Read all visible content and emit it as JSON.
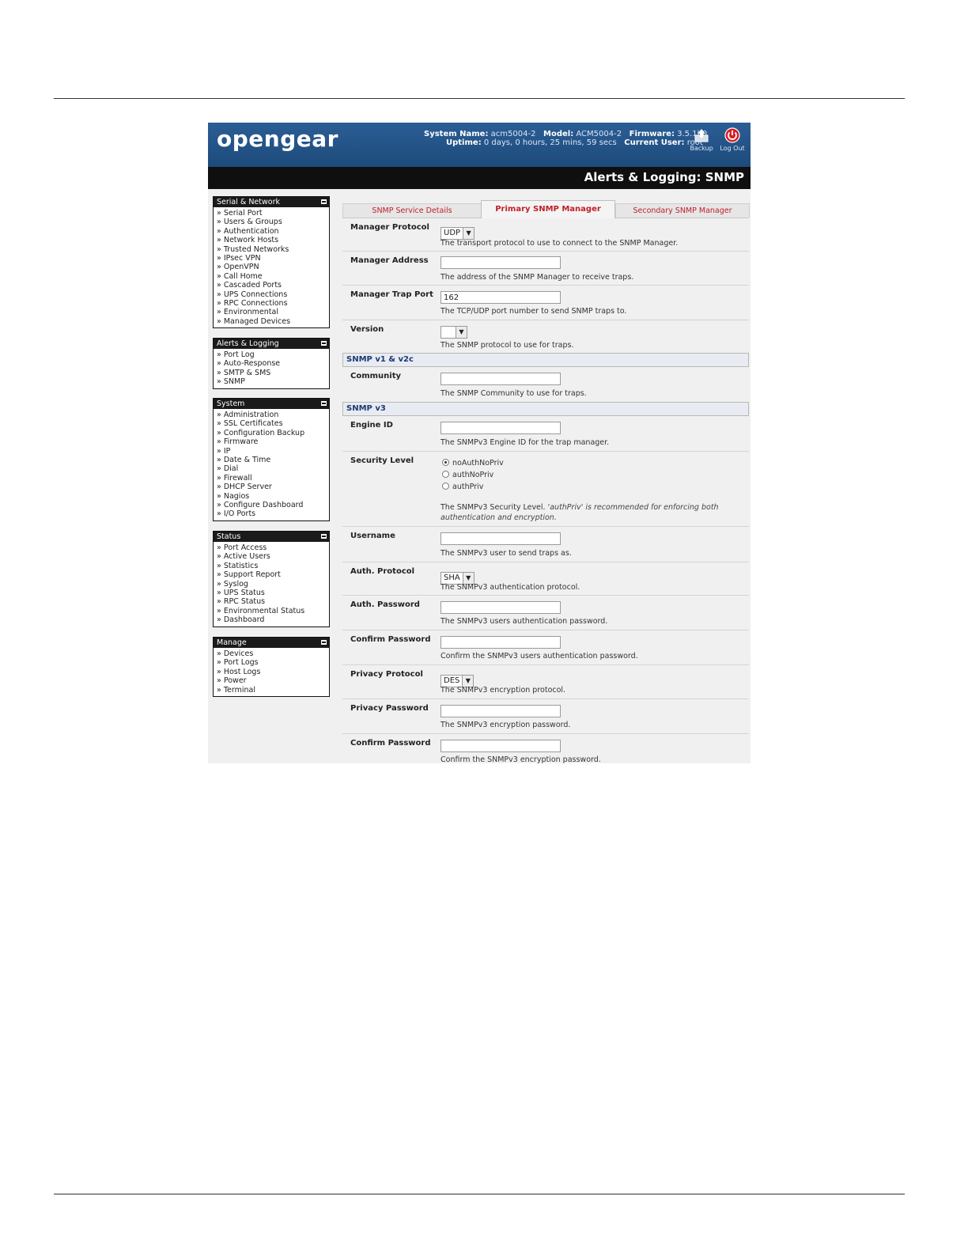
{
  "header": {
    "logo": "opengear",
    "system_name_label": "System Name:",
    "system_name": "acm5004-2",
    "model_label": "Model:",
    "model": "ACM5004-2",
    "firmware_label": "Firmware:",
    "firmware": "3.5.1b0",
    "uptime_label": "Uptime:",
    "uptime": "0 days, 0 hours, 25 mins, 59 secs",
    "current_user_label": "Current User:",
    "current_user": "root",
    "backup_label": "Backup",
    "logout_label": "Log Out",
    "page_title": "Alerts & Logging: SNMP"
  },
  "sidebar": {
    "serial_network": {
      "title": "Serial & Network",
      "items": [
        "Serial Port",
        "Users & Groups",
        "Authentication",
        "Network Hosts",
        "Trusted Networks",
        "IPsec VPN",
        "OpenVPN",
        "Call Home",
        "Cascaded Ports",
        "UPS Connections",
        "RPC Connections",
        "Environmental",
        "Managed Devices"
      ]
    },
    "alerts_logging": {
      "title": "Alerts & Logging",
      "items": [
        "Port Log",
        "Auto-Response",
        "SMTP & SMS",
        "SNMP"
      ]
    },
    "system": {
      "title": "System",
      "items": [
        "Administration",
        "SSL Certificates",
        "Configuration Backup",
        "Firmware",
        "IP",
        "Date & Time",
        "Dial",
        "Firewall",
        "DHCP Server",
        "Nagios",
        "Configure Dashboard",
        "I/O Ports"
      ]
    },
    "status": {
      "title": "Status",
      "items": [
        "Port Access",
        "Active Users",
        "Statistics",
        "Support Report",
        "Syslog",
        "UPS Status",
        "RPC Status",
        "Environmental Status",
        "Dashboard"
      ]
    },
    "manage": {
      "title": "Manage",
      "items": [
        "Devices",
        "Port Logs",
        "Host Logs",
        "Power",
        "Terminal"
      ]
    }
  },
  "tabs": [
    "SNMP Service Details",
    "Primary SNMP Manager",
    "Secondary SNMP Manager"
  ],
  "form": {
    "manager_protocol": {
      "label": "Manager Protocol",
      "value": "UDP",
      "help": "The transport protocol to use to connect to the SNMP Manager."
    },
    "manager_address": {
      "label": "Manager Address",
      "value": "",
      "help": "The address of the SNMP Manager to receive traps."
    },
    "manager_trap_port": {
      "label": "Manager Trap Port",
      "value": "162",
      "help": "The TCP/UDP port number to send SNMP traps to."
    },
    "version": {
      "label": "Version",
      "value": "",
      "help": "The SNMP protocol to use for traps."
    },
    "section_v1": "SNMP v1 & v2c",
    "community": {
      "label": "Community",
      "value": "",
      "help": "The SNMP Community to use for traps."
    },
    "section_v3": "SNMP v3",
    "engine_id": {
      "label": "Engine ID",
      "value": "",
      "help": "The SNMPv3 Engine ID for the trap manager."
    },
    "security_level": {
      "label": "Security Level",
      "options": [
        "noAuthNoPriv",
        "authNoPriv",
        "authPriv"
      ],
      "selected": "noAuthNoPriv",
      "help": "The SNMPv3 Security Level.",
      "help_italic_1": "'authPriv' is recommended for enforcing both",
      "help_italic_2": "authentication and encryption."
    },
    "username": {
      "label": "Username",
      "value": "",
      "help": "The SNMPv3 user to send traps as."
    },
    "auth_protocol": {
      "label": "Auth. Protocol",
      "value": "SHA",
      "help": "The SNMPv3 authentication protocol."
    },
    "auth_password": {
      "label": "Auth. Password",
      "value": "",
      "help": "The SNMPv3 users authentication password."
    },
    "confirm_auth_password": {
      "label": "Confirm Password",
      "value": "",
      "help": "Confirm the SNMPv3 users authentication password."
    },
    "privacy_protocol": {
      "label": "Privacy Protocol",
      "value": "DES",
      "help": "The SNMPv3 encryption protocol."
    },
    "privacy_password": {
      "label": "Privacy Password",
      "value": "",
      "help": "The SNMPv3 encryption password."
    },
    "confirm_privacy_password": {
      "label": "Confirm Password",
      "value": "",
      "help": "Confirm the SNMPv3 encryption password."
    }
  },
  "colors": {
    "header_blue": "#1d4a7a",
    "tab_red": "#c0202a",
    "section_text": "#1b3a73"
  }
}
